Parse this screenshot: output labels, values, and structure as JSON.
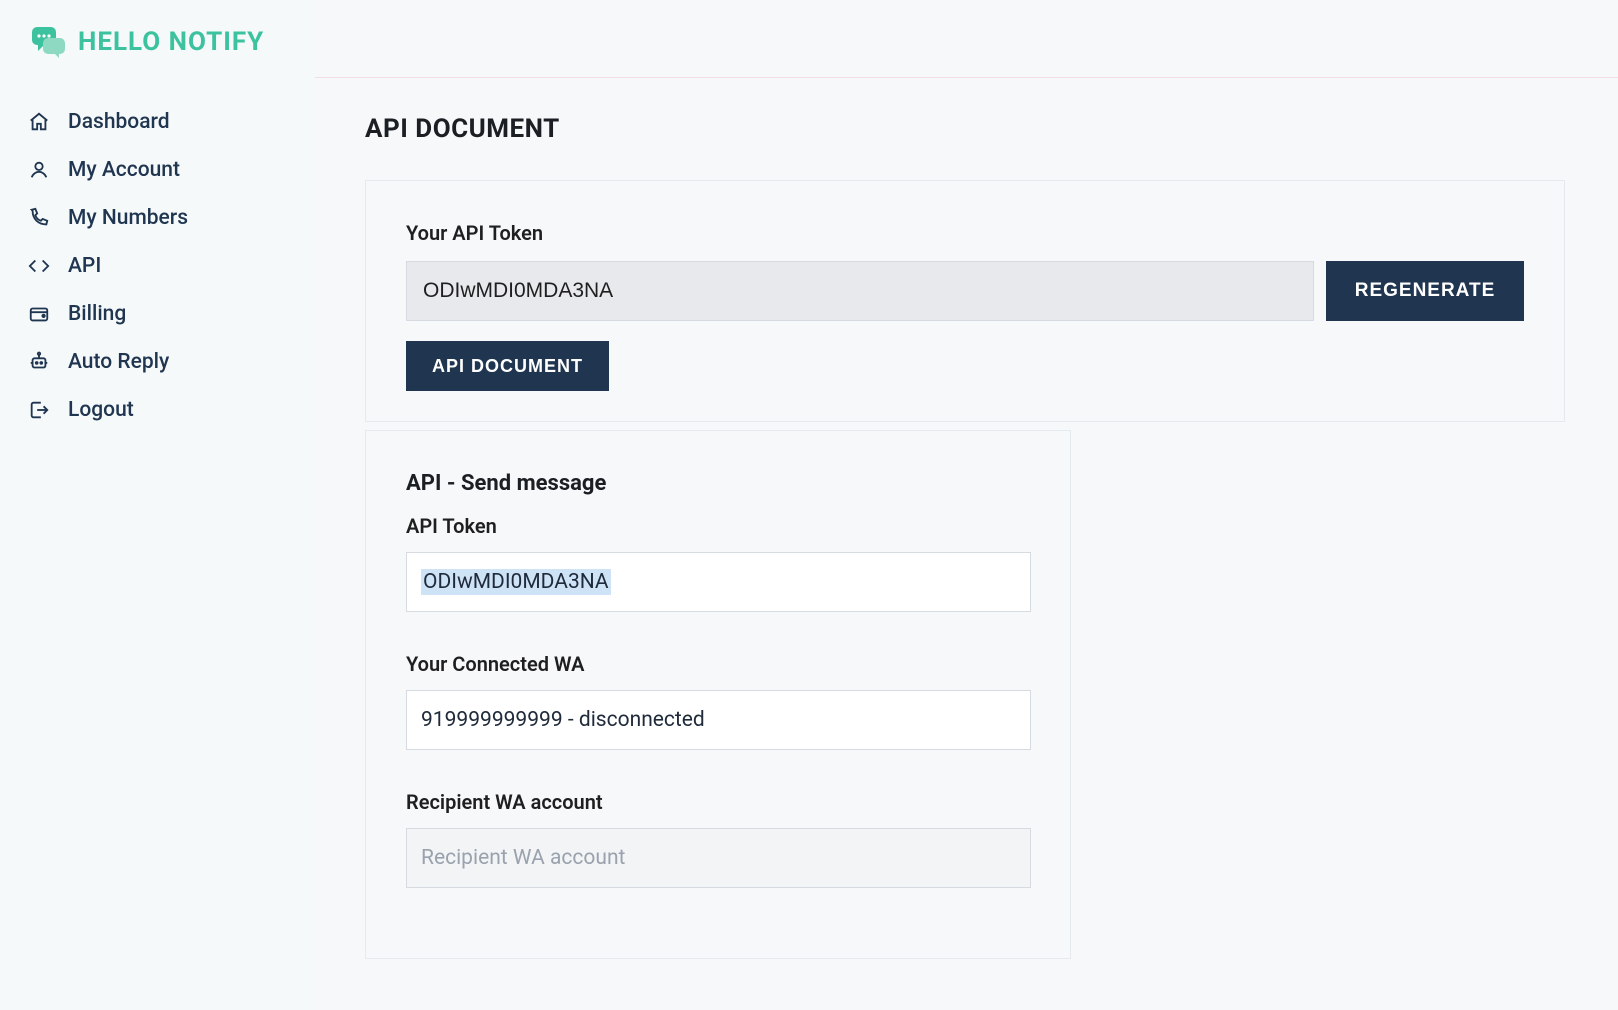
{
  "brand": {
    "name": "HELLO NOTIFY"
  },
  "sidebar": {
    "items": [
      {
        "label": "Dashboard"
      },
      {
        "label": "My Account"
      },
      {
        "label": "My Numbers"
      },
      {
        "label": "API"
      },
      {
        "label": "Billing"
      },
      {
        "label": "Auto Reply"
      },
      {
        "label": "Logout"
      }
    ]
  },
  "page": {
    "title": "API DOCUMENT"
  },
  "token_card": {
    "label": "Your API Token",
    "value": "ODIwMDI0MDA3NA",
    "regenerate_label": "REGENERATE",
    "doc_button_label": "API DOCUMENT"
  },
  "send_message": {
    "title": "API - Send message",
    "api_token_label": "API Token",
    "api_token_value": "ODIwMDI0MDA3NA",
    "connected_wa_label": "Your Connected WA",
    "connected_wa_value": "919999999999 - disconnected",
    "recipient_label": "Recipient WA account",
    "recipient_placeholder": "Recipient WA account",
    "recipient_value": ""
  },
  "colors": {
    "accent": "#3cc29e",
    "btn_bg": "#1f3550"
  }
}
